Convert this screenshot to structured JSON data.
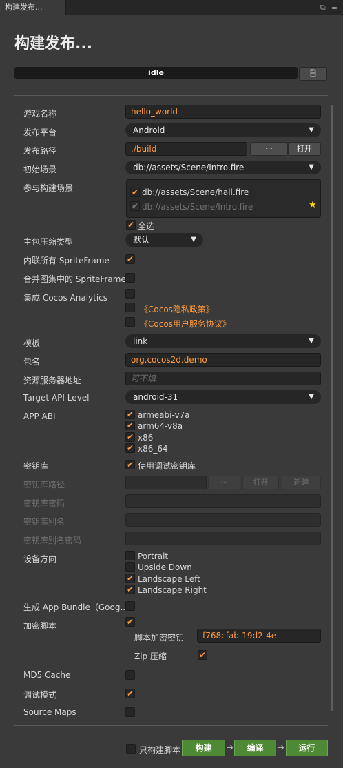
{
  "window": {
    "tab_title": "构建发布...",
    "tab_icons": [
      "maximize-icon",
      "menu-icon"
    ],
    "page_title": "构建发布..."
  },
  "status": {
    "text": "idle"
  },
  "form": {
    "game_name": {
      "label": "游戏名称",
      "value": "hello_world"
    },
    "platform": {
      "label": "发布平台",
      "value": "Android"
    },
    "build_path": {
      "label": "发布路径",
      "value": "./build",
      "browse": "···",
      "open": "打开"
    },
    "start_scene": {
      "label": "初始场景",
      "value": "db://assets/Scene/Intro.fire"
    },
    "scenes": {
      "label": "参与构建场景",
      "items": [
        {
          "path": "db://assets/Scene/hall.fire",
          "checked": true,
          "disabled": false
        },
        {
          "path": "db://assets/Scene/Intro.fire",
          "checked": true,
          "disabled": true
        }
      ],
      "select_all": "全选"
    },
    "compress": {
      "label": "主包压缩类型",
      "value": "默认"
    },
    "inline_sf": {
      "label": "内联所有 SpriteFrame",
      "checked": true
    },
    "merge_sf": {
      "label": "合并图集中的 SpriteFrame",
      "checked": false
    },
    "analytics": {
      "label": "集成 Cocos Analytics",
      "privacy": "《Cocos隐私政策》",
      "agreement": "《Cocos用户服务协议》"
    },
    "template": {
      "label": "模板",
      "value": "link"
    },
    "package": {
      "label": "包名",
      "value": "org.cocos2d.demo"
    },
    "server": {
      "label": "资源服务器地址",
      "placeholder": "可不填"
    },
    "api_level": {
      "label": "Target API Level",
      "value": "android-31"
    },
    "abi": {
      "label": "APP ABI",
      "items": [
        "armeabi-v7a",
        "arm64-v8a",
        "x86",
        "x86_64"
      ]
    },
    "keystore": {
      "label": "密钥库",
      "use_debug": "使用调试密钥库",
      "path_label": "密钥库路径",
      "browse": "···",
      "open": "打开",
      "new": "新建",
      "password_label": "密钥库密码",
      "alias_label": "密钥库别名",
      "alias_password_label": "密钥库别名密码"
    },
    "orientation": {
      "label": "设备方向",
      "items": [
        {
          "name": "Portrait",
          "checked": false
        },
        {
          "name": "Upside Down",
          "checked": false
        },
        {
          "name": "Landscape Left",
          "checked": true
        },
        {
          "name": "Landscape Right",
          "checked": true
        }
      ]
    },
    "app_bundle": {
      "label": "生成 App Bundle（Goog..."
    },
    "encrypt": {
      "label": "加密脚本",
      "key_label": "脚本加密密钥",
      "key_value": "f768cfab-19d2-4e",
      "zip_label": "Zip 压缩"
    },
    "md5": {
      "label": "MD5 Cache"
    },
    "debug": {
      "label": "调试模式"
    },
    "source_maps": {
      "label": "Source Maps"
    }
  },
  "footer": {
    "only_script": "只构建脚本",
    "build": "构建",
    "compile": "编译",
    "run": "运行"
  },
  "colors": {
    "accent": "#ff9a3c",
    "green": "#4e8a35",
    "star": "#ffd400"
  }
}
